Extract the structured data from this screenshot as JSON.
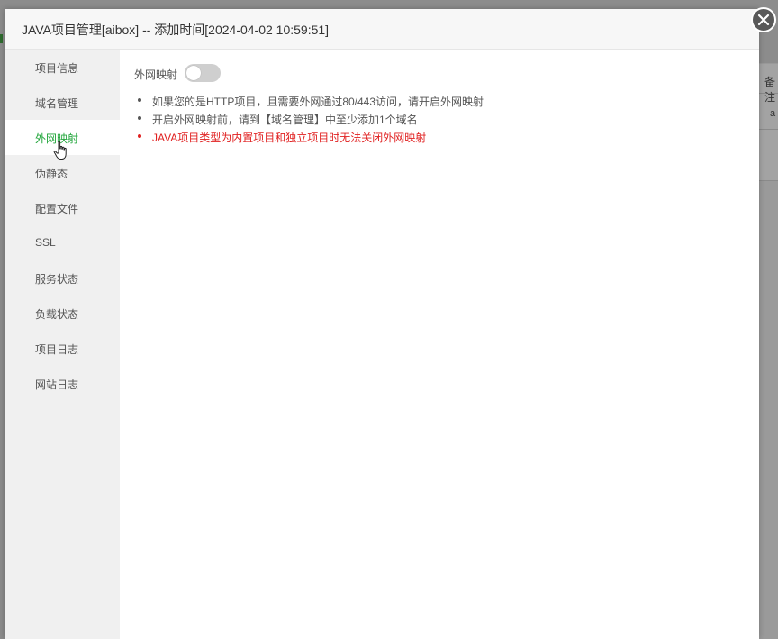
{
  "background": {
    "column_header": "备注",
    "cell_text": "a"
  },
  "dialog": {
    "title": "JAVA项目管理[aibox] -- 添加时间[2024-04-02 10:59:51]",
    "close_icon": "close-icon"
  },
  "sidebar": {
    "items": [
      {
        "label": "项目信息"
      },
      {
        "label": "域名管理"
      },
      {
        "label": "外网映射",
        "active": true
      },
      {
        "label": "伪静态"
      },
      {
        "label": "配置文件"
      },
      {
        "label": "SSL"
      },
      {
        "label": "服务状态"
      },
      {
        "label": "负载状态"
      },
      {
        "label": "项目日志"
      },
      {
        "label": "网站日志"
      }
    ]
  },
  "content": {
    "toggle_label": "外网映射",
    "toggle_on": false,
    "tips": [
      "如果您的是HTTP项目，且需要外网通过80/443访问，请开启外网映射",
      "开启外网映射前，请到【域名管理】中至少添加1个域名",
      "JAVA项目类型为内置项目和独立项目时无法关闭外网映射"
    ]
  },
  "colors": {
    "accent": "#20a53a",
    "warning": "#e02020",
    "toggle_off": "#cfcfcf"
  }
}
